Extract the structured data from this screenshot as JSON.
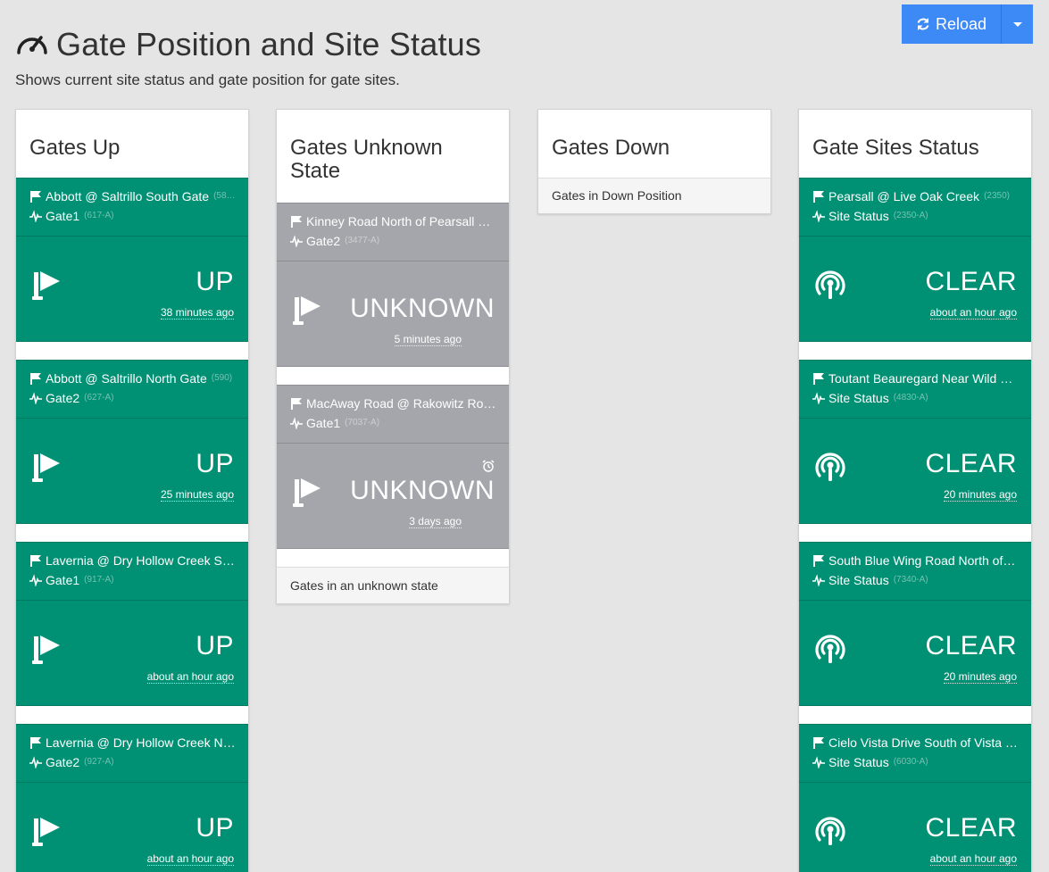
{
  "header": {
    "title": "Gate Position and Site Status",
    "subtitle": "Shows current site status and gate position for gate sites.",
    "title_icon": "speedometer-icon"
  },
  "toolbar": {
    "reload_label": "Reload",
    "reload_icon": "refresh-icon",
    "accent": "#3d8af7"
  },
  "colors": {
    "up": "#009073",
    "unknown": "#a5a6ab",
    "clear": "#009073"
  },
  "columns": {
    "gates_up": {
      "title": "Gates Up",
      "items": [
        {
          "site": "Abbott @ Saltrillo South Gate",
          "site_code": "(58…",
          "gate": "Gate1",
          "gate_code": "(617-A)",
          "status": "UP",
          "time": "38 minutes ago"
        },
        {
          "site": "Abbott @ Saltrillo North Gate",
          "site_code": "(590)",
          "gate": "Gate2",
          "gate_code": "(627-A)",
          "status": "UP",
          "time": "25 minutes ago"
        },
        {
          "site": "Lavernia @ Dry Hollow Creek So…",
          "site_code": "",
          "gate": "Gate1",
          "gate_code": "(917-A)",
          "status": "UP",
          "time": "about an hour ago"
        },
        {
          "site": "Lavernia @ Dry Hollow Creek No…",
          "site_code": "",
          "gate": "Gate2",
          "gate_code": "(927-A)",
          "status": "UP",
          "time": "about an hour ago"
        }
      ]
    },
    "gates_unknown": {
      "title": "Gates Unknown State",
      "footer": "Gates in an unknown state",
      "items": [
        {
          "site": "Kinney Road North of Pearsall G…",
          "gate": "Gate2",
          "gate_code": "(3477-A)",
          "status": "UNKNOWN",
          "time": "5 minutes ago",
          "alarm": false
        },
        {
          "site": "MacAway Road @ Rakowitz Roa…",
          "gate": "Gate1",
          "gate_code": "(7037-A)",
          "status": "UNKNOWN",
          "time": "3 days ago",
          "alarm": true
        }
      ]
    },
    "gates_down": {
      "title": "Gates Down",
      "footer": "Gates in Down Position"
    },
    "site_status": {
      "title": "Gate Sites Status",
      "items": [
        {
          "site": "Pearsall @ Live Oak Creek",
          "site_code": "(2350)",
          "label": "Site Status",
          "label_code": "(2350-A)",
          "status": "CLEAR",
          "time": "about an hour ago"
        },
        {
          "site": "Toutant Beauregard Near Wild S…",
          "site_code": "",
          "label": "Site Status",
          "label_code": "(4830-A)",
          "status": "CLEAR",
          "time": "20 minutes ago"
        },
        {
          "site": "South Blue Wing Road North of …",
          "site_code": "",
          "label": "Site Status",
          "label_code": "(7340-A)",
          "status": "CLEAR",
          "time": "20 minutes ago"
        },
        {
          "site": "Cielo Vista Drive South of Vista …",
          "site_code": "",
          "label": "Site Status",
          "label_code": "(6030-A)",
          "status": "CLEAR",
          "time": "about an hour ago"
        }
      ]
    }
  }
}
